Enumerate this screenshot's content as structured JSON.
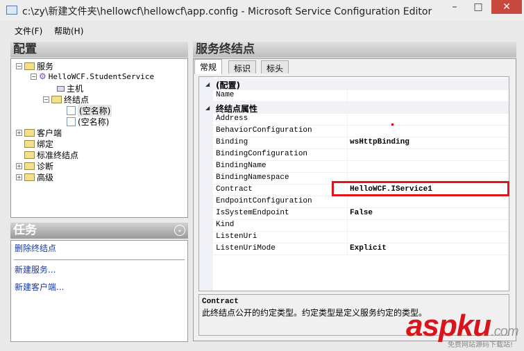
{
  "window": {
    "title": "c:\\zy\\新建文件夹\\hellowcf\\hellowcf\\app.config - Microsoft Service Configuration Editor",
    "minimize": "–",
    "maximize": "□",
    "close": "✕"
  },
  "menu": [
    "文件(F)",
    "帮助(H)"
  ],
  "left": {
    "header": "配置",
    "tree": {
      "services": "服务",
      "service": "HelloWCF.StudentService",
      "host": "主机",
      "endpoints": "终结点",
      "ep1": "(空名称)",
      "ep2": "(空名称)",
      "client": "客户端",
      "bindings": "绑定",
      "standard": "标准终结点",
      "diag": "诊断",
      "advanced": "高级"
    },
    "tasks_header": "任务",
    "tasks": [
      "删除终结点",
      "新建服务...",
      "新建客户端..."
    ]
  },
  "right": {
    "header": "服务终结点",
    "tabs": [
      "常规",
      "标识",
      "标头"
    ],
    "grid": [
      {
        "cat": "(配置)"
      },
      {
        "name": "Name",
        "value": ""
      },
      {
        "cat": "终结点属性"
      },
      {
        "name": "Address",
        "value": ""
      },
      {
        "name": "BehaviorConfiguration",
        "value": ""
      },
      {
        "name": "Binding",
        "value": "wsHttpBinding"
      },
      {
        "name": "BindingConfiguration",
        "value": ""
      },
      {
        "name": "BindingName",
        "value": ""
      },
      {
        "name": "BindingNamespace",
        "value": ""
      },
      {
        "name": "Contract",
        "value": "HelloWCF.IService1"
      },
      {
        "name": "EndpointConfiguration",
        "value": ""
      },
      {
        "name": "IsSystemEndpoint",
        "value": "False"
      },
      {
        "name": "Kind",
        "value": ""
      },
      {
        "name": "ListenUri",
        "value": ""
      },
      {
        "name": "ListenUriMode",
        "value": "Explicit"
      }
    ],
    "desc_title": "Contract",
    "desc_text": "此终结点公开的约定类型。约定类型是定义服务约定的类型。"
  },
  "watermark": {
    "logo": "aspku",
    "domain": ".com",
    "slogan": "免费网站源码下载站!"
  },
  "colors": {
    "highlight": "#e0141a",
    "link": "#1a3a9a"
  }
}
